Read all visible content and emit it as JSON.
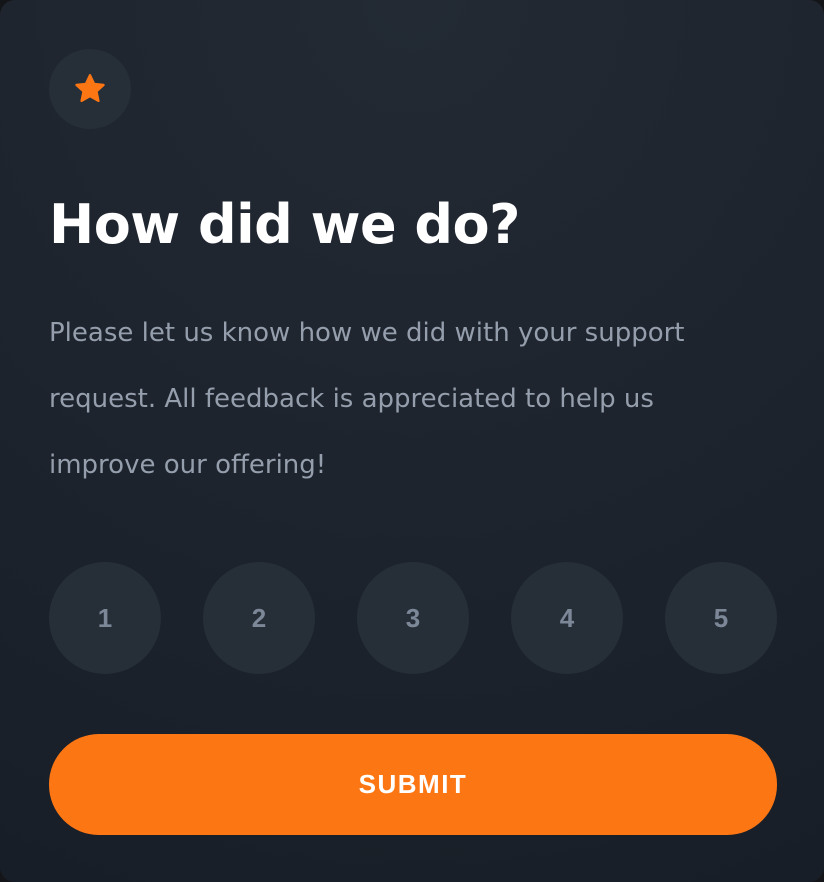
{
  "card": {
    "icon": "star-icon",
    "title": "How did we do?",
    "description": "Please let us know how we did with your support request. All feedback is appreciated to help us improve our offering!",
    "rating_options": [
      "1",
      "2",
      "3",
      "4",
      "5"
    ],
    "submit_label": "SUBMIT"
  },
  "colors": {
    "accent": "#fc7614",
    "background": "#181e27",
    "circle": "#262e38",
    "text_muted": "#959eac",
    "rating_text": "#7c8798"
  }
}
